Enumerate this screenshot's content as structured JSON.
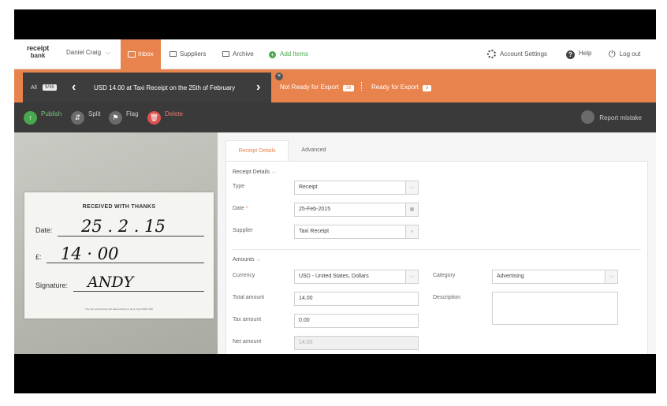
{
  "nav": {
    "logo_line1": "receipt",
    "logo_line2": "bank",
    "user": "Daniel Craig",
    "inbox": "Inbox",
    "suppliers": "Suppliers",
    "archive": "Archive",
    "add_items": "Add Items",
    "account_settings": "Account Settings",
    "help": "Help",
    "logout": "Log out"
  },
  "orange_bar": {
    "all_label": "All",
    "all_count": "9/36",
    "receipt_title": "USD 14.00 at Taxi Receipt on the 25th of February",
    "not_ready_label": "Not Ready for Export",
    "not_ready_count": "28",
    "ready_label": "Ready for Export",
    "ready_count": "8"
  },
  "toolbar": {
    "publish": "Publish",
    "split": "Split",
    "flag": "Flag",
    "delete": "Delete",
    "report": "Report mistake"
  },
  "receipt_image": {
    "heading": "RECEIVED WITH THANKS",
    "date_label": "Date:",
    "date_value": "25 . 2 . 15",
    "amount_label": "£:",
    "amount_value": "14 · 00",
    "signature_label": "Signature:",
    "signature_value": "ANDY",
    "footer": "The taxi card printing visit www.printing.co.uk or ring 0 000 0 000"
  },
  "tabs": {
    "receipt_details": "Receipt Details",
    "advanced": "Advanced"
  },
  "form": {
    "receipt_details_title": "Receipt Details",
    "type_label": "Type",
    "type_value": "Receipt",
    "date_label": "Date",
    "date_required": "*",
    "date_value": "25-Feb-2015",
    "supplier_label": "Supplier",
    "supplier_value": "Taxi Receipt",
    "amounts_title": "Amounts",
    "currency_label": "Currency",
    "currency_value": "USD - United States, Dollars",
    "category_label": "Category",
    "category_value": "Advertising",
    "total_label": "Total amount",
    "total_value": "14.00",
    "description_label": "Description",
    "tax_label": "Tax amount",
    "tax_value": "0.00",
    "net_label": "Net amount",
    "net_value": "14.00"
  },
  "colors": {
    "accent": "#e8834d",
    "dark": "#3a3a3a",
    "green": "#49a84d",
    "red": "#d9534f"
  }
}
